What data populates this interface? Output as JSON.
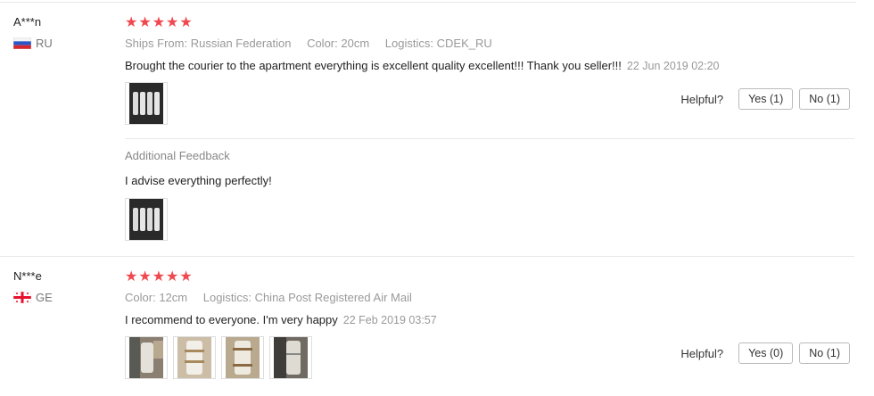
{
  "reviews": [
    {
      "user": "A***n",
      "country": "RU",
      "stars": "★★★★★",
      "meta": [
        {
          "key": "Ships From:",
          "value": "Russian Federation"
        },
        {
          "key": "Color:",
          "value": "20cm"
        },
        {
          "key": "Logistics:",
          "value": "CDEK_RU"
        }
      ],
      "text": "Brought the courier to the apartment everything is excellent quality excellent!!! Thank you seller!!!",
      "date": "22 Jun 2019 02:20",
      "helpful_label": "Helpful?",
      "yes_label": "Yes (1)",
      "no_label": "No (1)",
      "additional_title": "Additional Feedback",
      "additional_text": "I advise everything perfectly!"
    },
    {
      "user": "N***e",
      "country": "GE",
      "stars": "★★★★★",
      "meta": [
        {
          "key": "Color:",
          "value": "12cm"
        },
        {
          "key": "Logistics:",
          "value": "China Post Registered Air Mail"
        }
      ],
      "text": "I recommend to everyone. I'm very happy",
      "date": "22 Feb 2019 03:57",
      "helpful_label": "Helpful?",
      "yes_label": "Yes (0)",
      "no_label": "No (1)"
    }
  ],
  "colors": {
    "star": "#f0484e",
    "muted": "#999999"
  }
}
